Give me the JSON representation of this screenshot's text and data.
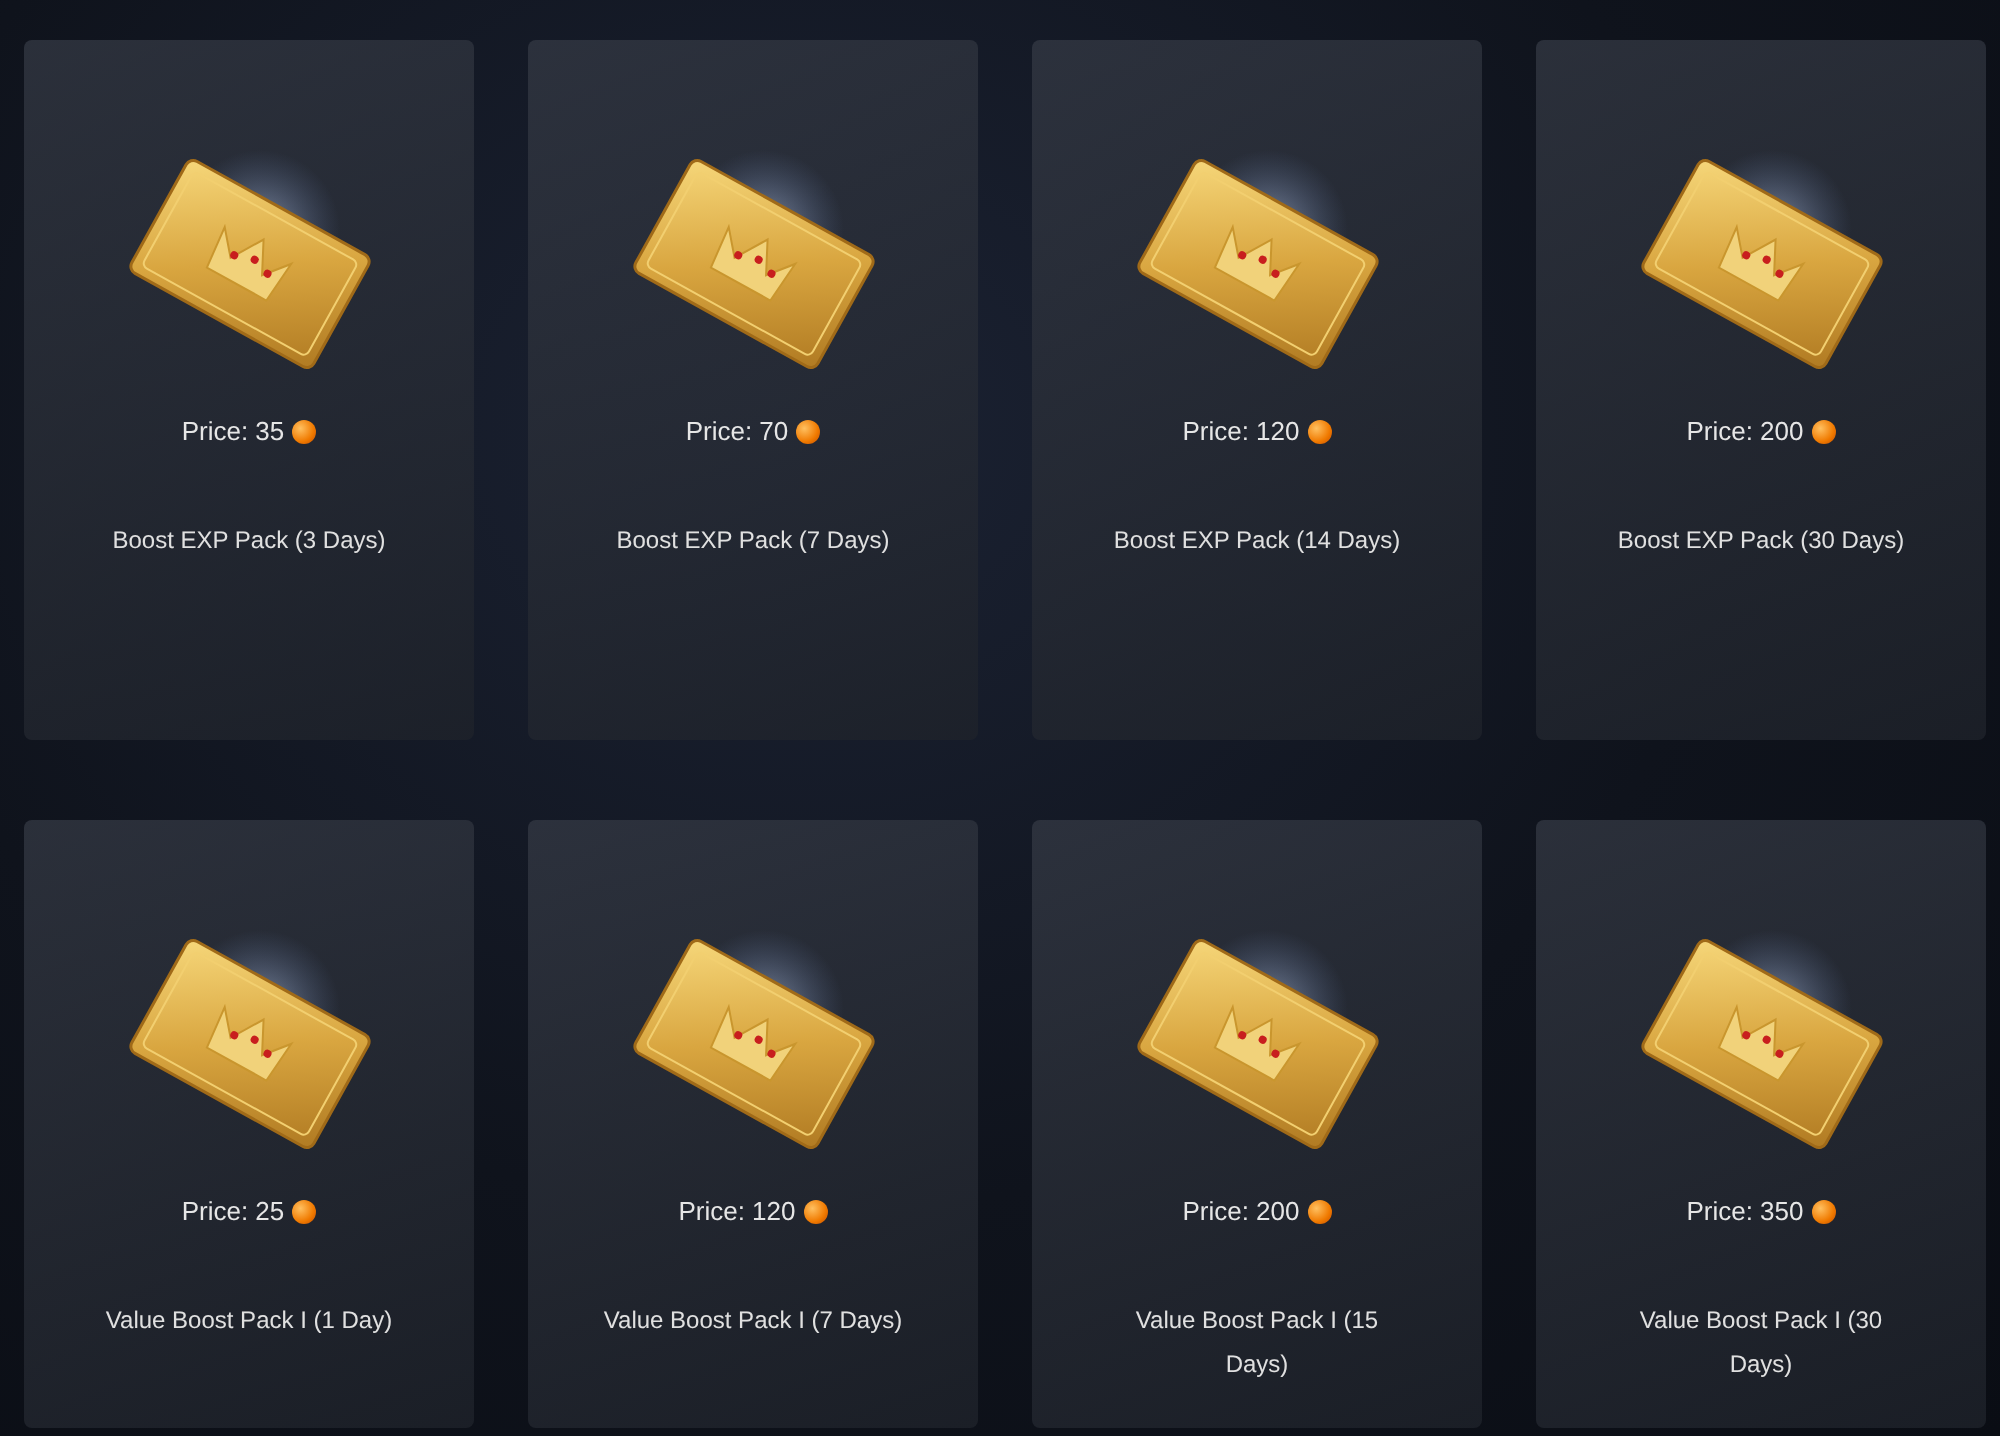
{
  "items": [
    {
      "price_label": "Price: 35",
      "name": "Boost EXP Pack (3 Days)"
    },
    {
      "price_label": "Price: 70",
      "name": "Boost EXP Pack (7 Days)"
    },
    {
      "price_label": "Price: 120",
      "name": "Boost EXP Pack (14 Days)"
    },
    {
      "price_label": "Price: 200",
      "name": "Boost EXP Pack (30 Days)"
    },
    {
      "price_label": "Price: 25",
      "name": "Value Boost Pack I (1 Day)"
    },
    {
      "price_label": "Price: 120",
      "name": "Value Boost Pack I (7 Days)"
    },
    {
      "price_label": "Price: 200",
      "name": "Value Boost Pack I (15 Days)"
    },
    {
      "price_label": "Price: 350",
      "name": "Value Boost Pack I (30 Days)"
    }
  ]
}
